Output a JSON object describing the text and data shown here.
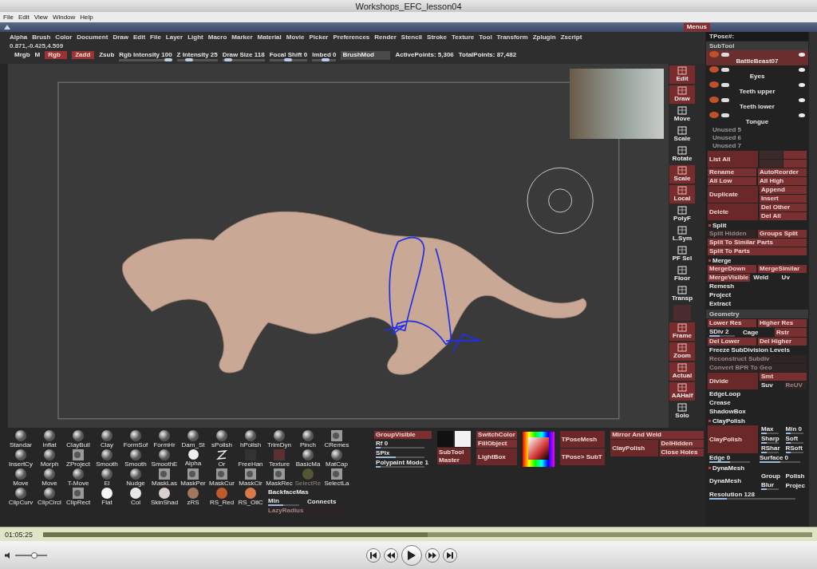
{
  "window": {
    "title": "Workshops_EFC_lesson04"
  },
  "menu": [
    "File",
    "Edit",
    "View",
    "Window",
    "Help"
  ],
  "zbrush": {
    "strip_button": "Menus",
    "menu": [
      "Alpha",
      "Brush",
      "Color",
      "Document",
      "Draw",
      "Edit",
      "File",
      "Layer",
      "Light",
      "Macro",
      "Marker",
      "Material",
      "Movie",
      "Picker",
      "Preferences",
      "Render",
      "Stencil",
      "Stroke",
      "Texture",
      "Tool",
      "Transform",
      "Zplugin",
      "Zscript"
    ],
    "coordinates": "0.871,-0.425,4.509",
    "toolbar": [
      {
        "kind": "text",
        "label": "Mrgb"
      },
      {
        "kind": "text",
        "label": "M"
      },
      {
        "kind": "toggle",
        "label": "Rgb"
      },
      {
        "kind": "toggle",
        "label": "Zadd"
      },
      {
        "kind": "text",
        "label": "Zsub"
      },
      {
        "kind": "slider",
        "label": "Rgb Intensity 100",
        "level": 1
      },
      {
        "kind": "slider",
        "label": "Z Intensity 25",
        "level": 0.25
      },
      {
        "kind": "slider",
        "label": "Draw Size 118",
        "level": 0.05
      },
      {
        "kind": "slider",
        "label": "Focal Shift 0",
        "level": 0.5
      },
      {
        "kind": "slider",
        "label": "Imbed 0",
        "level": 0.6
      },
      {
        "kind": "field",
        "label": "BrushMod"
      },
      {
        "kind": "text",
        "label": "ActivePoints: 5,306"
      },
      {
        "kind": "text",
        "label": "TotalPoints: 87,482"
      }
    ],
    "shelf": [
      {
        "kind": "lit",
        "label": "Edit"
      },
      {
        "kind": "lit",
        "label": "Draw"
      },
      {
        "kind": "plain",
        "label": "Move"
      },
      {
        "kind": "plain",
        "label": "Scale"
      },
      {
        "kind": "plain",
        "label": "Rotate"
      },
      {
        "kind": "lit",
        "label": "Scale"
      },
      {
        "kind": "lit",
        "label": "Local"
      },
      {
        "kind": "plain",
        "label": "PolyF"
      },
      {
        "kind": "plain",
        "label": "L.Sym"
      },
      {
        "kind": "plain",
        "label": "PF Sel"
      },
      {
        "kind": "plain",
        "label": "Floor"
      },
      {
        "kind": "plain",
        "label": "Transp"
      },
      {
        "kind": "blank"
      },
      {
        "kind": "lit",
        "label": "Frame"
      },
      {
        "kind": "lit",
        "label": "Zoom"
      },
      {
        "kind": "lit",
        "label": "Actual"
      },
      {
        "kind": "lit",
        "label": "AAHalf"
      },
      {
        "kind": "plain",
        "label": "Solo"
      }
    ],
    "palette": {
      "top": [
        {
          "kind": "sphere",
          "label": "Standar"
        },
        {
          "kind": "sphere",
          "label": "Inflat"
        },
        {
          "kind": "sphere",
          "label": "ClayBuil"
        },
        {
          "kind": "sphere",
          "label": "Clay"
        },
        {
          "kind": "sphere",
          "label": "FormSof"
        },
        {
          "kind": "sphere",
          "label": "FormHr"
        },
        {
          "kind": "sphere",
          "label": "Dam_St"
        },
        {
          "kind": "sphere",
          "label": "sPolish"
        },
        {
          "kind": "sphere",
          "label": "hPolish"
        },
        {
          "kind": "sphere",
          "label": "TrimDyn"
        },
        {
          "kind": "sphere",
          "label": "Pinch"
        },
        {
          "kind": "square",
          "label": "CRemes"
        },
        {
          "kind": "sphere",
          "label": "InsertCy"
        },
        {
          "kind": "sphere",
          "label": "Morph"
        },
        {
          "kind": "square",
          "label": "ZProject"
        },
        {
          "kind": "sphere",
          "label": "Smooth"
        },
        {
          "kind": "sphere",
          "label": "Smooth"
        },
        {
          "kind": "sphere",
          "label": "SmoothE"
        },
        {
          "kind": "alpha",
          "label": "Alpha"
        },
        {
          "kind": "stroke",
          "label": "Or"
        },
        {
          "kind": "text",
          "label": "FreeHan"
        },
        {
          "kind": "texture",
          "label": "Texture"
        },
        {
          "kind": "sphere",
          "label": "BasicMa"
        },
        {
          "kind": "sphere",
          "label": "MatCap"
        }
      ],
      "bottom": [
        {
          "kind": "sphere",
          "label": "Move"
        },
        {
          "kind": "sphere",
          "label": "Move"
        },
        {
          "kind": "sphere",
          "label": "T-Move"
        },
        {
          "kind": "sphere",
          "label": "El"
        },
        {
          "kind": "sphere",
          "label": "Nudge"
        },
        {
          "kind": "square",
          "label": "MaskLas"
        },
        {
          "kind": "square",
          "label": "MaskPer"
        },
        {
          "kind": "square",
          "label": "MaskCur"
        },
        {
          "kind": "square",
          "label": "MaskCir"
        },
        {
          "kind": "square",
          "label": "MaskRec"
        },
        {
          "kind": "inactive",
          "label": "SelectRe"
        },
        {
          "kind": "square",
          "label": "SelectLa"
        },
        {
          "kind": "sphere",
          "label": "ClipCurv"
        },
        {
          "kind": "sphere",
          "label": "ClipCircl"
        },
        {
          "kind": "square",
          "label": "ClipRect"
        }
      ],
      "options": [
        [
          {
            "kind": "text",
            "label": "BackfaceMas"
          }
        ],
        [
          {
            "kind": "slider",
            "label": "Min",
            "level": 0.5
          },
          {
            "kind": "text",
            "label": "Connects"
          }
        ],
        [
          {
            "kind": "inactive",
            "label": "LazyRadius"
          }
        ]
      ],
      "materials": [
        {
          "label": "Flat",
          "color": "#f4f4f4"
        },
        {
          "label": "Col",
          "color": "#e8e8e8"
        },
        {
          "label": "SkinShad",
          "color": "#d8d0cc"
        },
        {
          "label": "zRS",
          "color": "#a07860"
        },
        {
          "label": "RS_Red",
          "color": "#c05a2a"
        },
        {
          "label": "RS_OilC",
          "color": "#d87a4a"
        }
      ]
    },
    "tools": [
      [
        [
          {
            "kind": "button",
            "label": "GroupVisible"
          }
        ],
        [
          {
            "kind": "slider",
            "label": "Rf 0",
            "level": 0.1
          }
        ],
        [
          {
            "kind": "slider",
            "label": "SPix",
            "level": 0.4
          }
        ],
        [
          {
            "kind": "slider",
            "label": "Polypaint Mode 1",
            "level": 0.1
          }
        ]
      ],
      [
        [
          {
            "kind": "swatch",
            "color": "#111111"
          },
          {
            "kind": "swatch",
            "color": "#f2f2f2"
          }
        ],
        [
          {
            "kind": "big",
            "label": "SubTool Master"
          }
        ]
      ],
      [
        [
          {
            "kind": "button",
            "label": "SwitchColor"
          }
        ],
        [
          {
            "kind": "button",
            "label": "FillObject"
          }
        ],
        [
          {
            "kind": "big",
            "label": "LightBox"
          }
        ]
      ],
      [
        [
          {
            "kind": "picker"
          }
        ]
      ],
      [
        [
          {
            "kind": "big",
            "label": "TPoseMesh"
          }
        ],
        [
          {
            "kind": "big",
            "label": "TPose> SubT"
          }
        ]
      ],
      [
        [
          {
            "kind": "button",
            "label": "Mirror And Weld"
          }
        ],
        [
          {
            "kind": "big",
            "label": "ClayPolish"
          },
          {
            "kind": "stack",
            "rows": [
              [
                {
                  "kind": "button",
                  "label": "DelHidden"
                }
              ],
              [
                {
                  "kind": "button",
                  "label": "Close Holes"
                }
              ]
            ]
          }
        ]
      ]
    ],
    "subtool": {
      "header": "TPose#:",
      "title": "SubTool",
      "items": [
        {
          "name": "BattleBeast07",
          "selected": true
        },
        {
          "name": "Eyes",
          "selected": false
        },
        {
          "name": "Teeth upper",
          "selected": false
        },
        {
          "name": "Teeth lower",
          "selected": false
        },
        {
          "name": "Tongue",
          "selected": false
        }
      ],
      "unused": [
        "Unused 5",
        "Unused 6",
        "Unused 7"
      ],
      "rows": [
        [
          {
            "kind": "big",
            "label": "List All"
          },
          {
            "kind": "arrows"
          }
        ],
        [
          {
            "kind": "button",
            "label": "Rename"
          },
          {
            "kind": "button",
            "label": "AutoReorder"
          }
        ],
        [
          {
            "kind": "button",
            "label": "All Low"
          },
          {
            "kind": "button",
            "label": "All High"
          }
        ],
        [
          {
            "kind": "big",
            "label": "Duplicate"
          },
          {
            "kind": "stack",
            "rows": [
              [
                {
                  "kind": "button",
                  "label": "Append"
                }
              ],
              [
                {
                  "kind": "button",
                  "label": "Insert"
                }
              ]
            ]
          }
        ],
        [
          {
            "kind": "big",
            "label": "Delete"
          },
          {
            "kind": "stack",
            "rows": [
              [
                {
                  "kind": "button",
                  "label": "Del Other"
                }
              ],
              [
                {
                  "kind": "button",
                  "label": "Del All"
                }
              ]
            ]
          }
        ],
        [
          {
            "kind": "section",
            "label": "Split"
          }
        ],
        [
          {
            "kind": "inactive",
            "label": "Split Hidden"
          },
          {
            "kind": "button",
            "label": "Groups Split"
          }
        ],
        [
          {
            "kind": "button",
            "label": "Split To Similar Parts"
          }
        ],
        [
          {
            "kind": "button",
            "label": "Split To Parts"
          }
        ],
        [
          {
            "kind": "section",
            "label": "Merge"
          }
        ],
        [
          {
            "kind": "button",
            "label": "MergeDown"
          },
          {
            "kind": "button",
            "label": "MergeSimilar"
          }
        ],
        [
          {
            "kind": "button",
            "label": "MergeVisible"
          },
          {
            "kind": "text",
            "label": "Weld"
          },
          {
            "kind": "text",
            "label": "Uv"
          }
        ],
        [
          {
            "kind": "text",
            "label": "Remesh"
          }
        ],
        [
          {
            "kind": "text",
            "label": "Project"
          }
        ],
        [
          {
            "kind": "text",
            "label": "Extract"
          }
        ]
      ]
    },
    "geometry": {
      "title": "Geometry",
      "rows": [
        [
          {
            "kind": "button",
            "label": "Lower Res"
          },
          {
            "kind": "button",
            "label": "Higher Res"
          }
        ],
        [
          {
            "kind": "slider",
            "label": "SDiv 2",
            "level": 0.4
          },
          {
            "kind": "text",
            "label": "Cage"
          },
          {
            "kind": "button",
            "label": "Rstr"
          }
        ],
        [
          {
            "kind": "button",
            "label": "Del Lower"
          },
          {
            "kind": "button",
            "label": "Del Higher"
          }
        ],
        [
          {
            "kind": "text",
            "label": "Freeze SubDivision Levels"
          }
        ],
        [
          {
            "kind": "inactive",
            "label": "Reconstruct Subdiv"
          }
        ],
        [
          {
            "kind": "inactive",
            "label": "Convert BPR To Geo"
          }
        ],
        [
          {
            "kind": "big",
            "label": "Divide"
          },
          {
            "kind": "stack",
            "rows": [
              [
                {
                  "kind": "button",
                  "label": "Smt"
                }
              ],
              [
                {
                  "kind": "text",
                  "label": "Suv"
                },
                {
                  "kind": "inactive",
                  "label": "ReUV"
                }
              ]
            ]
          }
        ],
        [
          {
            "kind": "text",
            "label": "EdgeLoop"
          }
        ],
        [
          {
            "kind": "text",
            "label": "Crease"
          }
        ],
        [
          {
            "kind": "text",
            "label": "ShadowBox"
          }
        ],
        [
          {
            "kind": "section",
            "label": "ClayPolish"
          }
        ],
        [
          {
            "kind": "big",
            "label": "ClayPolish"
          },
          {
            "kind": "stack",
            "rows": [
              [
                {
                  "kind": "slider",
                  "label": "Max",
                  "level": 0.3
                },
                {
                  "kind": "slider",
                  "label": "Min 0",
                  "level": 0.3
                }
              ],
              [
                {
                  "kind": "slider",
                  "label": "Sharp",
                  "level": 0.3
                },
                {
                  "kind": "slider",
                  "label": "Soft",
                  "level": 0.3
                }
              ],
              [
                {
                  "kind": "slider",
                  "label": "RShar",
                  "level": 0.3
                },
                {
                  "kind": "slider",
                  "label": "RSoft",
                  "level": 0.3
                }
              ]
            ]
          }
        ],
        [
          {
            "kind": "slider",
            "label": "Edge 0",
            "level": 0.5
          },
          {
            "kind": "slider",
            "label": "Surface 0",
            "level": 0.5
          }
        ],
        [
          {
            "kind": "section",
            "label": "DynaMesh"
          }
        ],
        [
          {
            "kind": "text",
            "label": "DynaMesh"
          },
          {
            "kind": "stack",
            "rows": [
              [
                {
                  "kind": "text",
                  "label": "Group"
                },
                {
                  "kind": "text",
                  "label": "Polish"
                }
              ],
              [
                {
                  "kind": "slider",
                  "label": "Blur",
                  "level": 0.3
                },
                {
                  "kind": "text",
                  "label": "Projec"
                }
              ]
            ]
          }
        ],
        [
          {
            "kind": "slider",
            "label": "Resolution 128",
            "level": 0.2
          }
        ]
      ]
    }
  },
  "player": {
    "time": "01:05:25",
    "position": {
      "level": 0.5
    },
    "volume": {
      "level": 0.6
    }
  }
}
